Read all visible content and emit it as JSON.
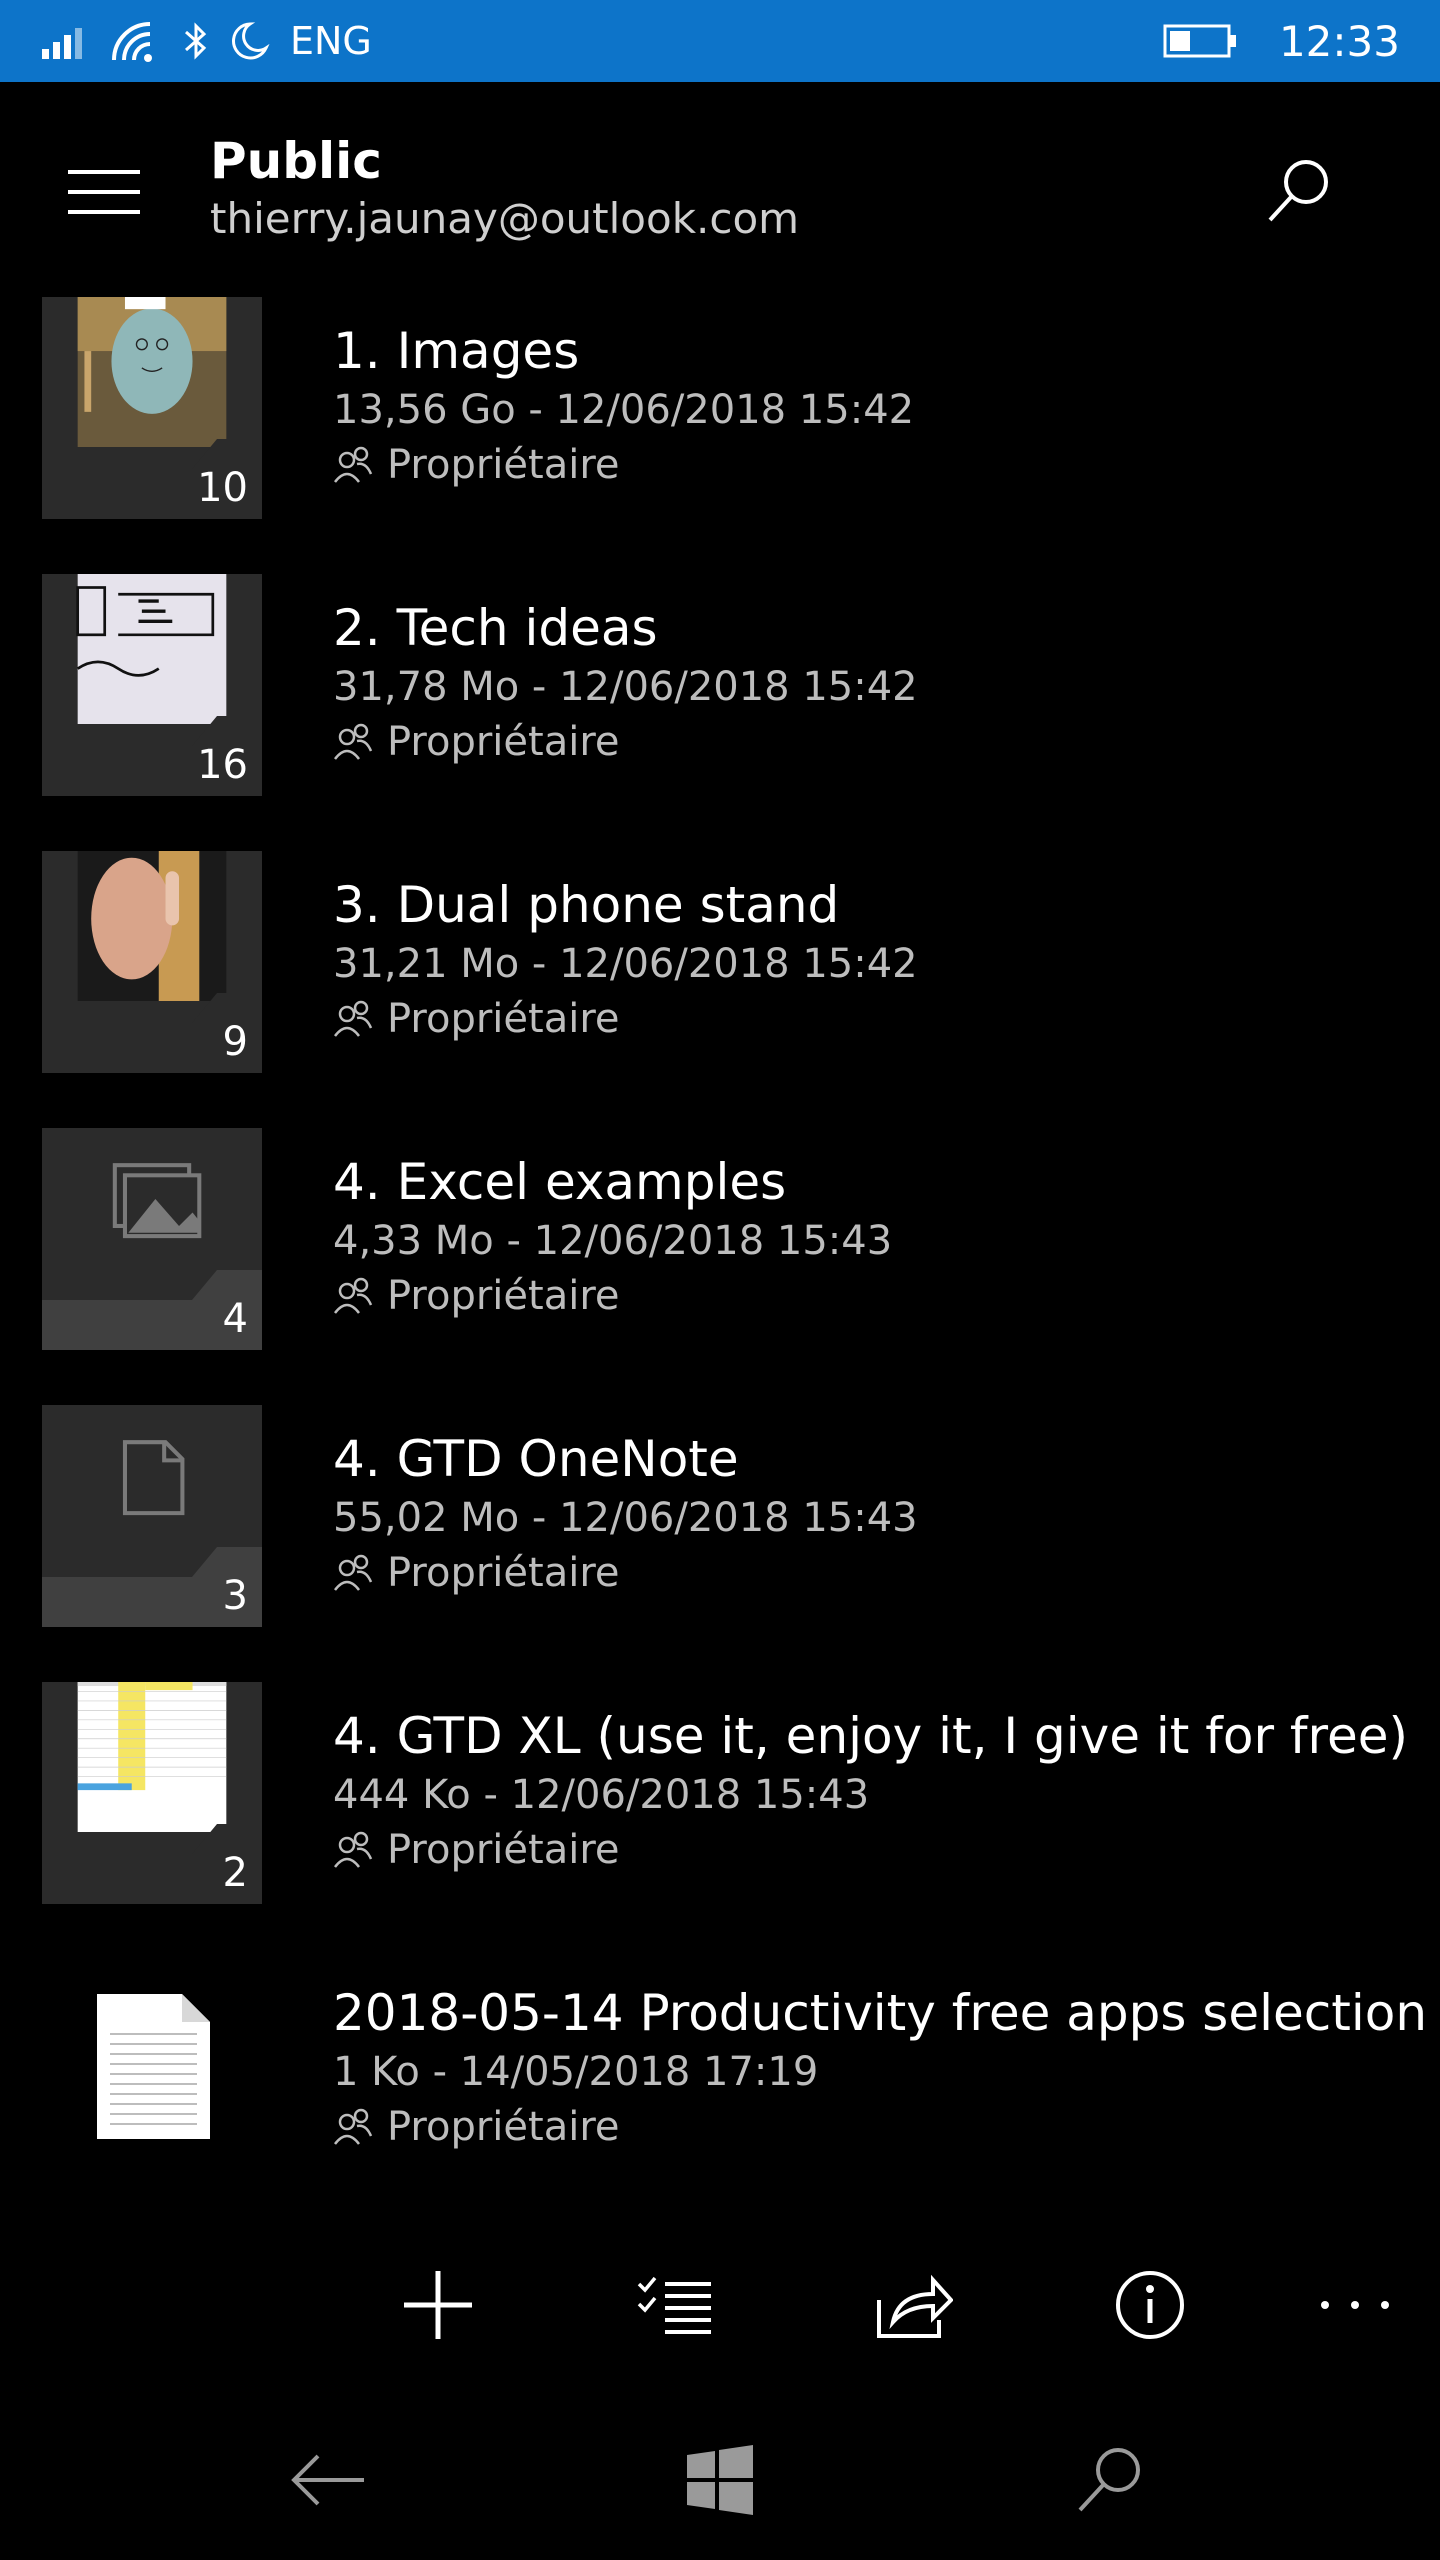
{
  "status_bar": {
    "language": "ENG",
    "time": "12:33",
    "icons": [
      "signal-icon",
      "wifi-icon",
      "bluetooth-icon",
      "quiet-hours-icon",
      "battery-icon"
    ],
    "background": "#0d74c9"
  },
  "header": {
    "title": "Public",
    "account": "thierry.jaunay@outlook.com"
  },
  "items": [
    {
      "title": "1. Images",
      "meta": "13,56 Go - 12/06/2018 15:42",
      "role": "Propriétaire",
      "count": "10",
      "thumb": "photo-face"
    },
    {
      "title": "2. Tech ideas",
      "meta": "31,78 Mo - 12/06/2018 15:42",
      "role": "Propriétaire",
      "count": "16",
      "thumb": "photo-whiteboard"
    },
    {
      "title": "3. Dual phone stand",
      "meta": "31,21 Mo - 12/06/2018 15:42",
      "role": "Propriétaire",
      "count": "9",
      "thumb": "photo-hand"
    },
    {
      "title": "4. Excel examples",
      "meta": "4,33 Mo - 12/06/2018 15:43",
      "role": "Propriétaire",
      "count": "4",
      "thumb": "images-icon"
    },
    {
      "title": "4. GTD OneNote",
      "meta": "55,02 Mo - 12/06/2018 15:43",
      "role": "Propriétaire",
      "count": "3",
      "thumb": "document-icon"
    },
    {
      "title": "4. GTD XL (use it, enjoy it, I give it for free)",
      "meta": "444 Ko - 12/06/2018 15:43",
      "role": "Propriétaire",
      "count": "2",
      "thumb": "spreadsheet-preview"
    },
    {
      "title": "2018-05-14 Productivity free apps selection",
      "meta": "1 Ko - 14/05/2018 17:19",
      "role": "Propriétaire",
      "count": "",
      "thumb": "text-file-icon"
    }
  ],
  "app_bar": [
    "add-icon",
    "select-icon",
    "share-icon",
    "info-icon",
    "more-icon"
  ],
  "nav_bar": [
    "back-icon",
    "windows-icon",
    "search-icon"
  ]
}
